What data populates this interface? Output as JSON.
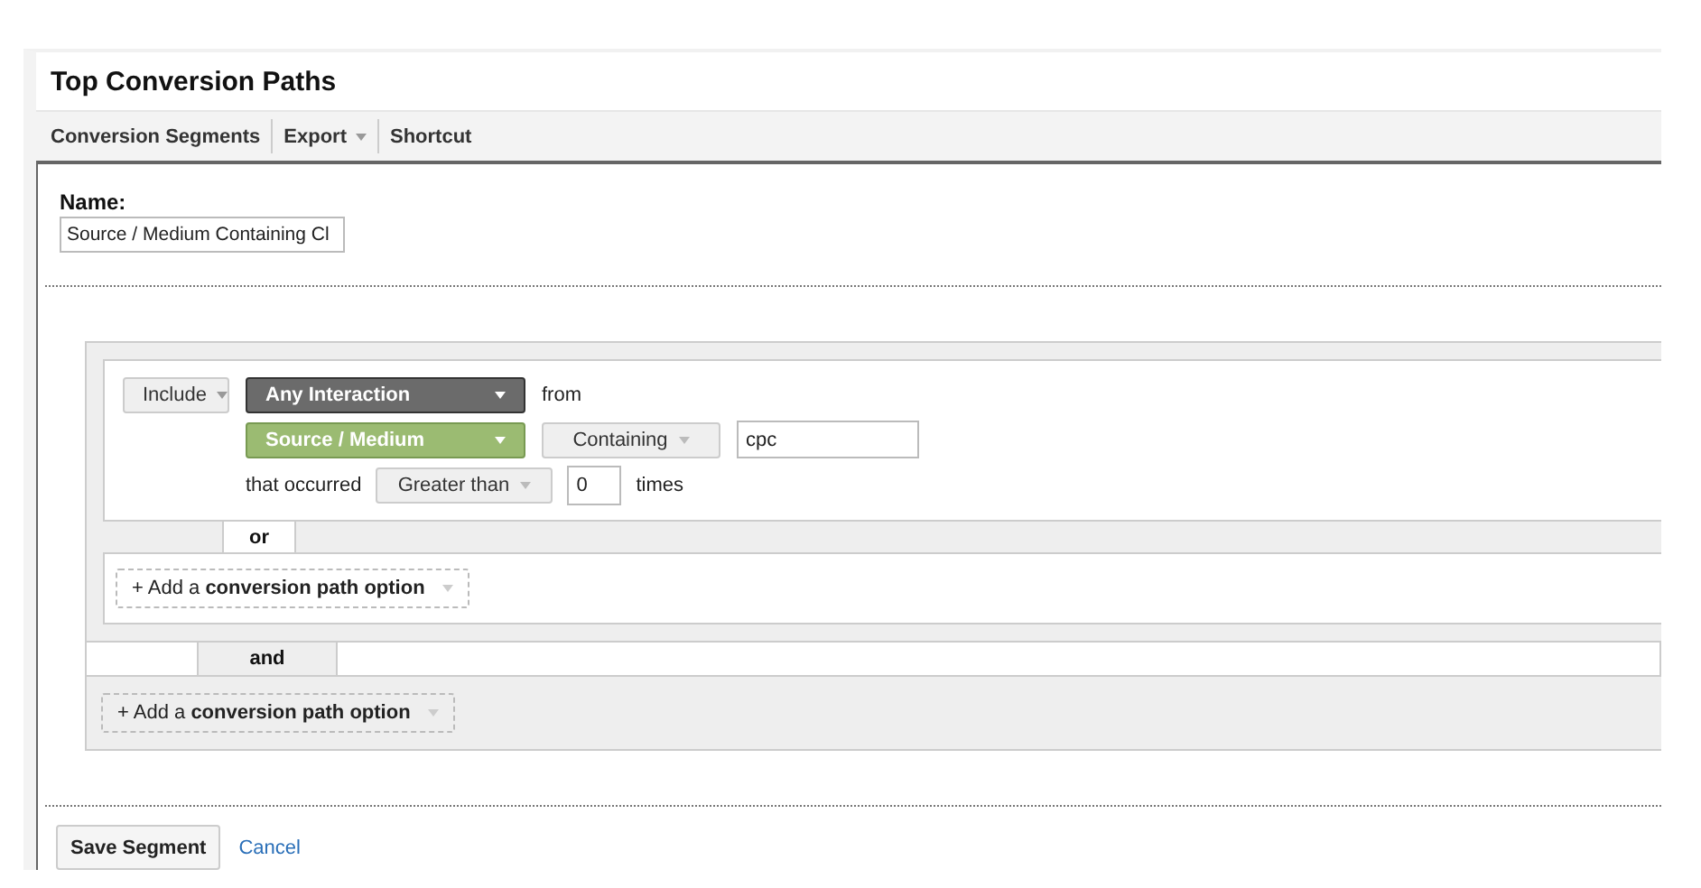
{
  "title": "Top Conversion Paths",
  "toolbar": [
    {
      "label": "Conversion Segments",
      "dropdown": false
    },
    {
      "label": "Export",
      "dropdown": true
    },
    {
      "label": "Shortcut",
      "dropdown": false
    }
  ],
  "name": {
    "label": "Name:",
    "value": "Source / Medium Containing Cl"
  },
  "groups": [
    {
      "conditions": [
        {
          "include": "Include",
          "interaction": "Any Interaction",
          "from": "from",
          "dimension": "Source / Medium",
          "match": "Containing",
          "value": "cpc",
          "occurred": "that occurred",
          "comparison": "Greater than",
          "count": "0",
          "times": "times"
        }
      ],
      "or_label": "or",
      "add_option": "+ Add a **conversion path option**"
    },
    {
      "add_option": "+ Add a **conversion path option**"
    }
  ],
  "and_label": "and",
  "actions": {
    "save": "Save Segment",
    "cancel": "Cancel"
  }
}
